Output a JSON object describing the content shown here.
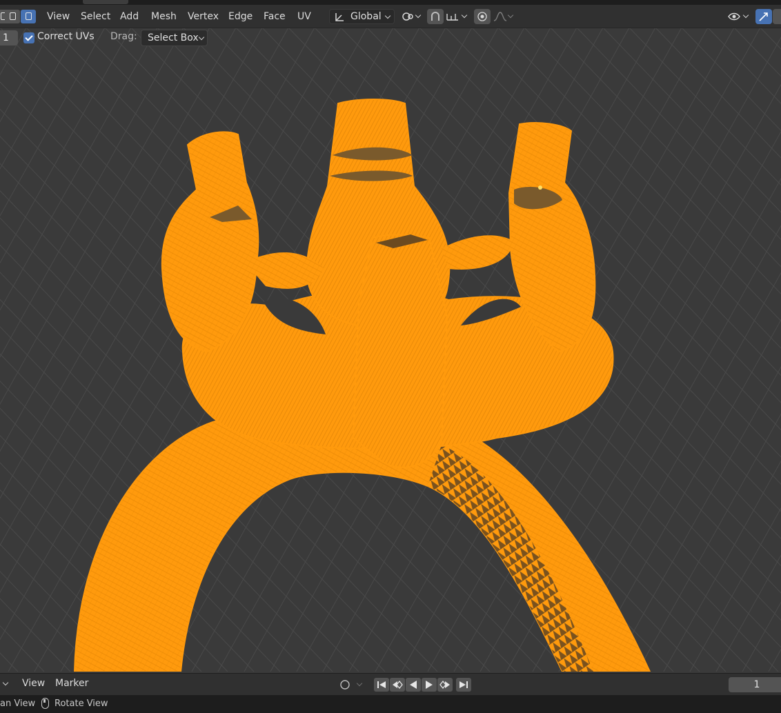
{
  "header": {
    "menus": [
      "View",
      "Select",
      "Add",
      "Mesh",
      "Vertex",
      "Edge",
      "Face",
      "UV"
    ],
    "transform_orientation": "Global",
    "icons": [
      "vertex-select-mode-icon",
      "edge-select-mode-icon",
      "face-select-mode-icon",
      "transform-orientation-icon",
      "pivot-point-icon",
      "snap-icon",
      "snap-increment-icon",
      "proportional-editing-icon",
      "proportional-falloff-icon",
      "visibility-icon",
      "gizmo-icon"
    ]
  },
  "tool_options": {
    "value": "1",
    "correct_uvs_label": "Correct UVs",
    "correct_uvs_checked": true,
    "drag_label": "Drag:",
    "drag_mode": "Select Box"
  },
  "viewport": {
    "mesh_color": "#ff9a0d",
    "grid_color": "#4a4a4a",
    "background_color": "#3a3a3a"
  },
  "timeline": {
    "menus": [
      "View",
      "Marker"
    ],
    "current_frame": "1",
    "controls": [
      "jump-start-icon",
      "prev-keyframe-icon",
      "play-reverse-icon",
      "play-icon",
      "next-keyframe-icon",
      "jump-end-icon"
    ]
  },
  "statusbar": {
    "pan_view": "an View",
    "rotate_view": "Rotate View"
  }
}
